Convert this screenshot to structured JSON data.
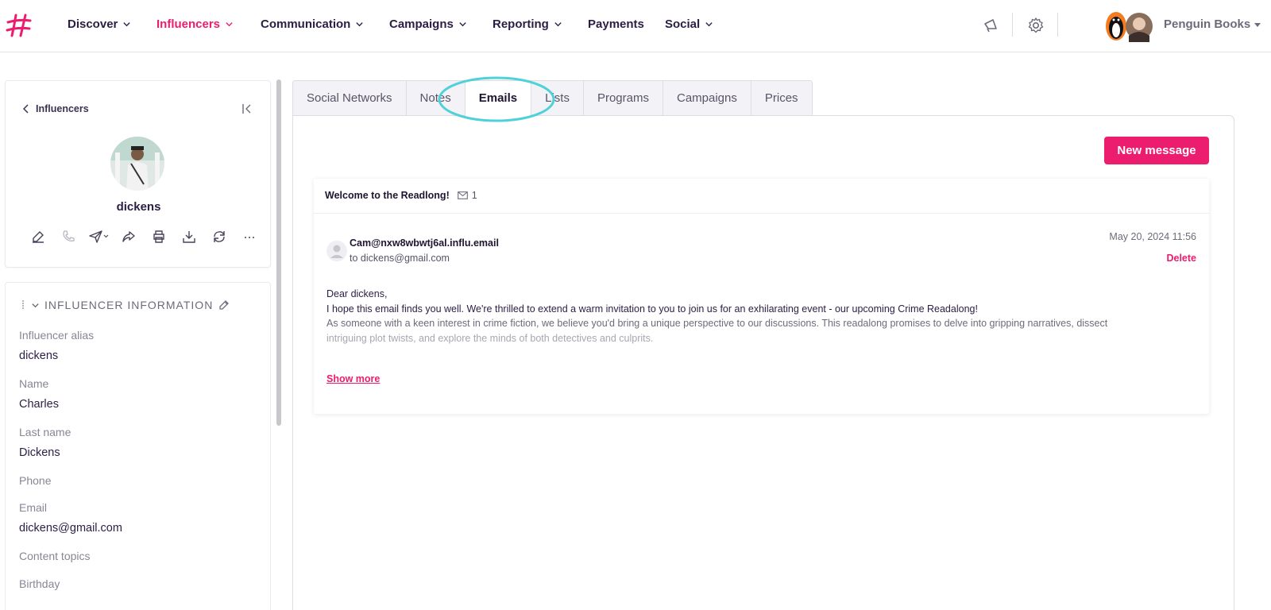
{
  "nav": {
    "items": [
      {
        "label": "Discover",
        "has_menu": true,
        "active": false
      },
      {
        "label": "Influencers",
        "has_menu": true,
        "active": true
      },
      {
        "label": "Communication",
        "has_menu": true,
        "active": false
      },
      {
        "label": "Campaigns",
        "has_menu": true,
        "active": false
      },
      {
        "label": "Reporting",
        "has_menu": true,
        "active": false
      },
      {
        "label": "Payments",
        "has_menu": false,
        "active": false
      },
      {
        "label": "Social",
        "has_menu": true,
        "active": false
      }
    ],
    "account_name": "Penguin Books",
    "icons": [
      "megaphone-icon",
      "gear-icon"
    ]
  },
  "profile": {
    "back_label": "Influencers",
    "name": "dickens",
    "actions": [
      "edit-icon",
      "phone-icon",
      "send-icon",
      "share-icon",
      "print-icon",
      "download-icon",
      "refresh-icon",
      "more-icon"
    ]
  },
  "info": {
    "header": "INFLUENCER INFORMATION",
    "fields": [
      {
        "label": "Influencer alias",
        "value": "dickens"
      },
      {
        "label": "Name",
        "value": "Charles"
      },
      {
        "label": "Last name",
        "value": "Dickens"
      },
      {
        "label": "Phone",
        "value": ""
      },
      {
        "label": "Email",
        "value": "dickens@gmail.com"
      },
      {
        "label": "Content topics",
        "value": ""
      },
      {
        "label": "Birthday",
        "value": ""
      }
    ]
  },
  "tabs": [
    "Social Networks",
    "Notes",
    "Emails",
    "Lists",
    "Programs",
    "Campaigns",
    "Prices"
  ],
  "active_tab": "Emails",
  "emails": {
    "new_message_label": "New message",
    "thread": {
      "subject": "Welcome to the Readlong!",
      "count": "1",
      "sender": "Cam@nxw8wbwtj6al.influ.email",
      "recipient": "to dickens@gmail.com",
      "date": "May 20, 2024 11:56",
      "delete_label": "Delete",
      "body": [
        "Dear dickens,",
        "I hope this email finds you well. We're thrilled to extend a warm invitation to you to join us for an exhilarating event - our upcoming Crime Readalong!",
        "As someone with a keen interest in crime fiction, we believe you'd bring a unique perspective to our discussions. This readalong promises to delve into gripping narratives, dissect",
        "intriguing plot twists, and explore the minds of both detectives and culprits."
      ],
      "show_more_label": "Show more"
    }
  },
  "colors": {
    "accent": "#ec1c6e",
    "highlight_ring": "#4fd1d9",
    "text": "#2b1d44"
  }
}
